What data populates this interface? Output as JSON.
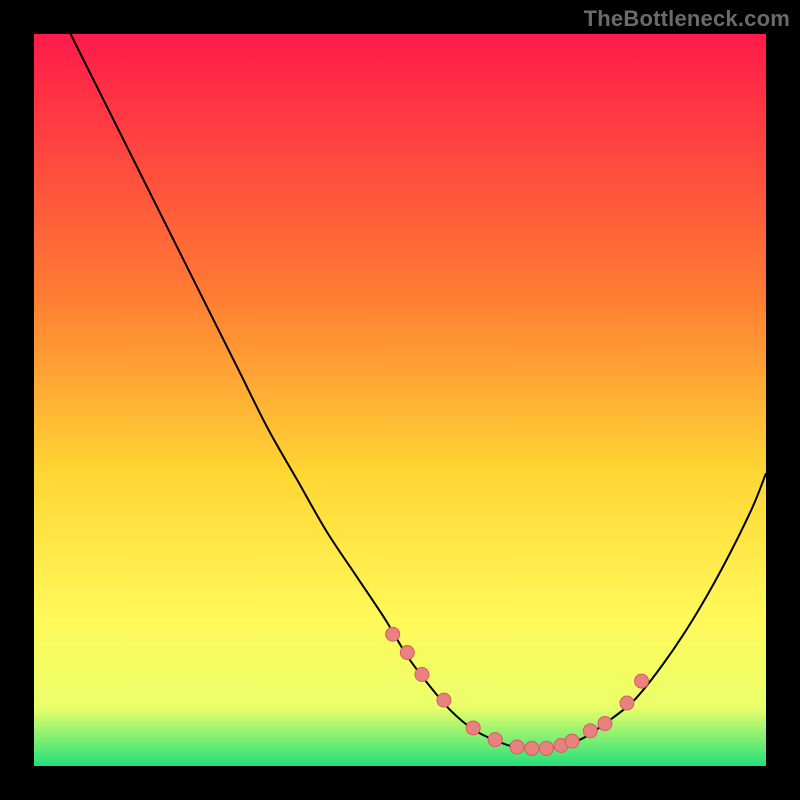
{
  "watermark": "TheBottleneck.com",
  "colors": {
    "dot_fill": "#e8817f",
    "dot_stroke": "#d65f5f",
    "curve": "#000000",
    "gradient_top": "#ff1a4a",
    "gradient_mid1": "#ff7a33",
    "gradient_mid2": "#ffd634",
    "gradient_mid3": "#fff95a",
    "gradient_mid4": "#eaff6a",
    "gradient_bottom": "#23e07a"
  },
  "chart_data": {
    "type": "line",
    "title": "",
    "xlabel": "",
    "ylabel": "",
    "xlim": [
      0,
      100
    ],
    "ylim": [
      0,
      100
    ],
    "series": [
      {
        "name": "bottleneck-curve",
        "x": [
          5,
          8,
          12,
          16,
          20,
          24,
          28,
          32,
          36,
          40,
          44,
          48,
          51,
          54,
          57,
          60,
          63,
          66,
          69,
          72,
          75,
          78,
          82,
          86,
          90,
          94,
          98,
          100
        ],
        "y": [
          100,
          94,
          86,
          78,
          70,
          62,
          54,
          46,
          39,
          32,
          26,
          20,
          15,
          11,
          7.5,
          5,
          3.5,
          2.5,
          2.3,
          2.7,
          3.8,
          5.8,
          9,
          14,
          20,
          27,
          35,
          40
        ]
      }
    ],
    "markers": {
      "name": "highlight-dots",
      "x": [
        49,
        51,
        53,
        56,
        60,
        63,
        66,
        68,
        70,
        72,
        73.5,
        76,
        78,
        81,
        83
      ],
      "y": [
        18,
        15.5,
        12.5,
        9,
        5.2,
        3.6,
        2.6,
        2.4,
        2.4,
        2.8,
        3.4,
        4.8,
        5.8,
        8.6,
        11.6
      ]
    }
  }
}
